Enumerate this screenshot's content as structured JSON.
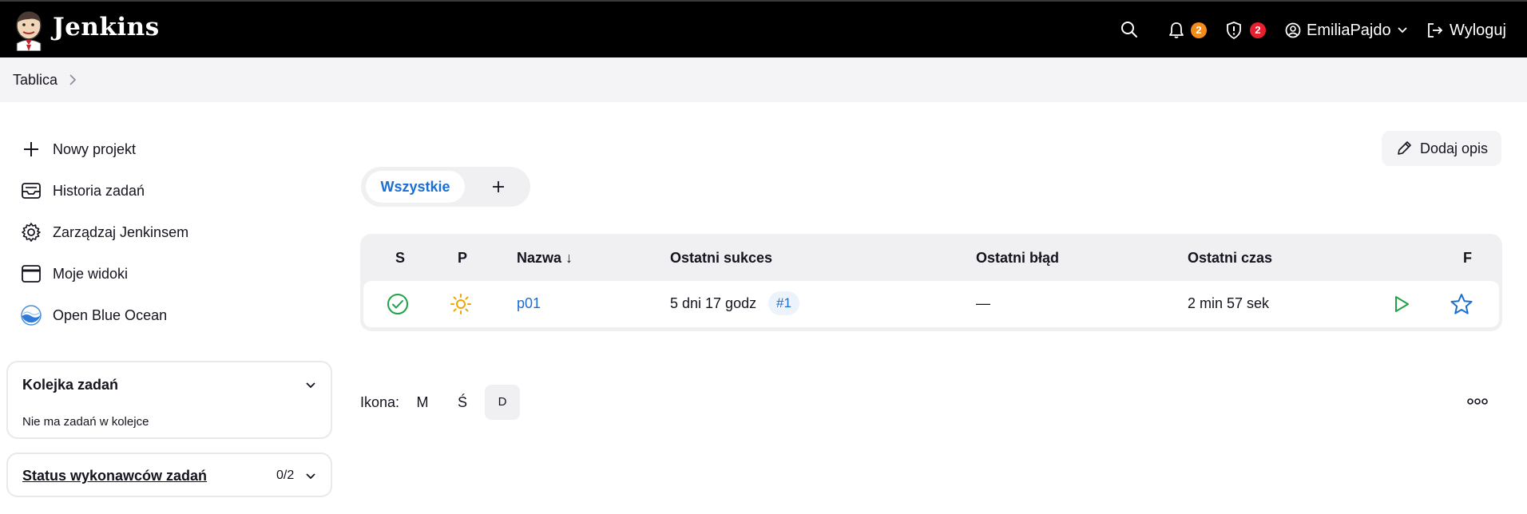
{
  "header": {
    "brand": "Jenkins",
    "notifications_count": "2",
    "security_count": "2",
    "user_name": "EmiliaPajdo",
    "logout_label": "Wyloguj"
  },
  "breadcrumb": {
    "items": [
      "Tablica"
    ]
  },
  "sidebar": {
    "tasks": [
      {
        "label": "Nowy projekt",
        "icon": "plus-icon"
      },
      {
        "label": "Historia zadań",
        "icon": "inbox-icon"
      },
      {
        "label": "Zarządzaj Jenkinsem",
        "icon": "gear-icon"
      },
      {
        "label": "Moje widoki",
        "icon": "window-icon"
      },
      {
        "label": "Open Blue Ocean",
        "icon": "blue-ocean-icon"
      }
    ],
    "queue": {
      "title": "Kolejka zadań",
      "empty_text": "Nie ma zadań w kolejce"
    },
    "executors": {
      "title": "Status wykonawców zadań",
      "count": "0/2"
    }
  },
  "main": {
    "add_description": "Dodaj opis",
    "tabs": [
      {
        "label": "Wszystkie",
        "active": true
      }
    ],
    "table": {
      "headers": {
        "status": "S",
        "weather": "P",
        "name": "Nazwa ↓",
        "last_success": "Ostatni sukces",
        "last_failure": "Ostatni błąd",
        "last_duration": "Ostatni czas",
        "favorite": "F"
      },
      "rows": [
        {
          "name": "p01",
          "last_success": "5 dni 17 godz",
          "last_success_build": "#1",
          "last_failure": "—",
          "last_duration": "2 min 57 sek"
        }
      ]
    },
    "icon_size": {
      "label": "Ikona:",
      "options": [
        "M",
        "Ś",
        "D"
      ],
      "selected": "D"
    }
  },
  "colors": {
    "header_bg": "#000000",
    "accent_blue": "#1b6fd0",
    "success_green": "#1ea446",
    "notification_orange": "#f28c1c",
    "security_red": "#e6202e",
    "weather_sun": "#f0a500"
  }
}
